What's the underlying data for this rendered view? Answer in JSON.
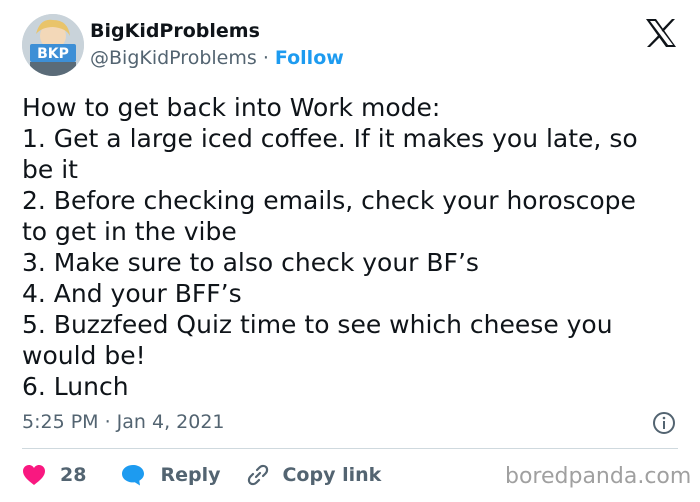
{
  "author": {
    "display_name": "BigKidProblems",
    "handle": "@BigKidProblems",
    "separator": "·",
    "follow_label": "Follow",
    "avatar_text": "BKP"
  },
  "tweet": {
    "lines": [
      "How to get back into Work mode:",
      "1. Get a large iced coffee. If it makes you late, so",
      "be it",
      "2. Before checking emails, check your horoscope",
      "to get in the vibe",
      "3. Make sure to also check your BF’s",
      "4. And your BFF’s",
      "5. Buzzfeed Quiz time to see which cheese you",
      "would be!",
      "6. Lunch"
    ],
    "timestamp": "5:25 PM · Jan 4, 2021"
  },
  "actions": {
    "like_count": "28",
    "reply_label": "Reply",
    "copy_link_label": "Copy link"
  },
  "watermark": "boredpanda.com",
  "icons": {
    "platform": "x-logo-icon",
    "info": "info-icon",
    "like": "heart-icon",
    "reply": "speech-bubble-icon",
    "copy": "link-icon"
  },
  "colors": {
    "accent": "#1d9bf0",
    "like": "#f91880",
    "text": "#0f1419",
    "secondary": "#536471"
  }
}
